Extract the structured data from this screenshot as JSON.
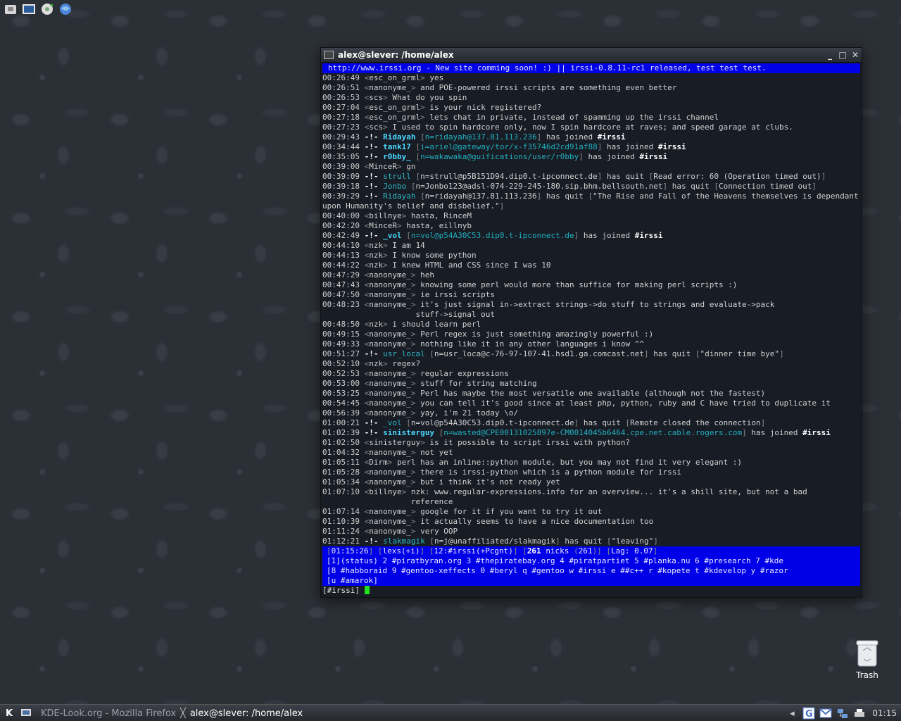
{
  "window": {
    "title": "alex@slever: /home/alex",
    "controls": [
      "_",
      "□",
      "✕"
    ]
  },
  "irssi": {
    "topic": "http://www.irssi.org - New site comming soon! :) || irssi-0.8.11-rc1 released, test test test.",
    "messages": [
      {
        "time": "00:26:49",
        "nick": "esc_on_grml",
        "text": "yes"
      },
      {
        "time": "00:26:51",
        "nick": "nanonyme_",
        "text": "and POE-powered irssi scripts are something even better"
      },
      {
        "time": "00:26:53",
        "nick": "scs",
        "text": "What do you spin"
      },
      {
        "time": "00:27:04",
        "nick": "esc_on_grml",
        "text": "is your nick registered?"
      },
      {
        "time": "00:27:18",
        "nick": "esc_on_grml",
        "text": "lets chat in private, instead of spamming up the irssi channel"
      },
      {
        "time": "00:27:23",
        "nick": "scs",
        "text": "I used to spin hardcore only, now I spin hardcore at raves; and speed garage at clubs."
      },
      {
        "time": "00:29:43",
        "type": "join",
        "nick": "Ridayah",
        "host": "n=ridayah@137.81.113.236",
        "channel": "#irssi"
      },
      {
        "time": "00:34:44",
        "type": "join",
        "nick": "tank17",
        "host": "i=ariel@gateway/tor/x-f35746d2cd91af88",
        "channel": "#irssi"
      },
      {
        "time": "00:35:05",
        "type": "join",
        "nick": "r0bby_",
        "host": "n=wakawaka@guifications/user/r0bby",
        "channel": "#irssi"
      },
      {
        "time": "00:39:00",
        "nick": "MinceR",
        "text": "gn"
      },
      {
        "time": "00:39:09",
        "type": "quit",
        "nick": "strull",
        "host": "n=strull@p5B151D94.dip0.t-ipconnect.de",
        "reason": "Read error: 60 (Operation timed out)"
      },
      {
        "time": "00:39:18",
        "type": "quit",
        "nick": "Jonbo",
        "host": "n=Jonbo123@adsl-074-229-245-180.sip.bhm.bellsouth.net",
        "reason": "Connection timed out"
      },
      {
        "time": "00:39:29",
        "type": "quit",
        "nick": "Ridayah",
        "host": "n=ridayah@137.81.113.236",
        "reason": "\"The Rise and Fall of the Heavens themselves is dependant upon Humanity's belief and disbelief.\"",
        "wrap": true
      },
      {
        "time": "00:40:00",
        "nick": "billnye",
        "text": "hasta, RinceM"
      },
      {
        "time": "00:42:20",
        "nick": "MinceR",
        "text": "hasta, eillnyb"
      },
      {
        "time": "00:42:49",
        "type": "join",
        "nick": "_vol",
        "host": "n=vol@p54A30C53.dip0.t-ipconnect.de",
        "channel": "#irssi"
      },
      {
        "time": "00:44:10",
        "nick": "nzk",
        "text": "I am 14"
      },
      {
        "time": "00:44:13",
        "nick": "nzk",
        "text": "I know some python"
      },
      {
        "time": "00:44:22",
        "nick": "nzk",
        "text": "I knew HTML and CSS since I was 10"
      },
      {
        "time": "00:47:29",
        "nick": "nanonyme_",
        "text": "heh"
      },
      {
        "time": "00:47:43",
        "nick": "nanonyme_",
        "text": "knowing some perl would more than suffice for making perl scripts :)"
      },
      {
        "time": "00:47:50",
        "nick": "nanonyme_",
        "text": "ie irssi scripts"
      },
      {
        "time": "00:48:23",
        "nick": "nanonyme_",
        "text": "it's just signal in->extract strings->do stuff to strings and evaluate->pack\n                    stuff->signal out",
        "wrap": true
      },
      {
        "time": "00:48:50",
        "nick": "nzk",
        "text": "i should learn perl"
      },
      {
        "time": "00:49:15",
        "nick": "nanonyme_",
        "text": "Perl regex is just something amazingly powerful :)"
      },
      {
        "time": "00:49:33",
        "nick": "nanonyme_",
        "text": "nothing like it in any other languages i know ^^"
      },
      {
        "time": "00:51:27",
        "type": "quit",
        "nick": "usr_local",
        "host": "n=usr_loca@c-76-97-107-41.hsd1.ga.comcast.net",
        "reason": "\"dinner time bye\""
      },
      {
        "time": "00:52:10",
        "nick": "nzk",
        "text": "regex?"
      },
      {
        "time": "00:52:53",
        "nick": "nanonyme_",
        "text": "regular expressions"
      },
      {
        "time": "00:53:00",
        "nick": "nanonyme_",
        "text": "stuff for string matching"
      },
      {
        "time": "00:53:25",
        "nick": "nanonyme_",
        "text": "Perl has maybe the most versatile one available (although not the fastest)"
      },
      {
        "time": "00:54:45",
        "nick": "nanonyme_",
        "text": "you can tell it's good since at least php, python, ruby and C have tried to duplicate it"
      },
      {
        "time": "00:56:39",
        "nick": "nanonyme_",
        "text": "yay, i'm 21 today \\o/"
      },
      {
        "time": "01:00:21",
        "type": "quit",
        "nick": "_vol",
        "host": "n=vol@p54A30C53.dip0.t-ipconnect.de",
        "reason": "Remote closed the connection"
      },
      {
        "time": "01:02:39",
        "type": "join",
        "nick": "sinisterguy",
        "host": "n=wasted@CPE00131025897e-CM0014045b6464.cpe.net.cable.rogers.com",
        "channel": "#irssi"
      },
      {
        "time": "01:02:50",
        "nick": "sinisterguy",
        "text": "is it possible to script irssi with python?"
      },
      {
        "time": "01:04:32",
        "nick": "nanonyme_",
        "text": "not yet"
      },
      {
        "time": "01:05:11",
        "nick": "Dirm",
        "text": "perl has an inline::python module, but you may not find it very elegant :)"
      },
      {
        "time": "01:05:28",
        "nick": "nanonyme_",
        "text": "there is irssi-python which is a python module for irssi"
      },
      {
        "time": "01:05:34",
        "nick": "nanonyme_",
        "text": "but i think it's not ready yet"
      },
      {
        "time": "01:07:10",
        "nick": "billnye",
        "text": "nzk: www.regular-expressions.info for an overview... it's a shill site, but not a bad\n                   reference",
        "wrap": true
      },
      {
        "time": "01:07:14",
        "nick": "nanonyme_",
        "text": "google for it if you want to try it out"
      },
      {
        "time": "01:10:39",
        "nick": "nanonyme_",
        "text": "it actually seems to have a nice documentation too"
      },
      {
        "time": "01:11:24",
        "nick": "nanonyme_",
        "text": "very OOP"
      },
      {
        "time": "01:12:21",
        "type": "quit",
        "nick": "slakmagik",
        "host": "n=j@unaffiliated/slakmagik",
        "reason": "\"leaving\""
      }
    ],
    "status": {
      "time": "01:15:26",
      "user": "lexs(+i)",
      "window": "12:#irssi(+Pcgnt)",
      "nicks_count": "261",
      "nicks_label": "nicks",
      "nicks_detail": "261",
      "lag": "Lag: 0.07"
    },
    "activity_lines": [
      "[1](status) 2 #piratbyran.org 3 #thepiratebay.org 4 #piratpartiet 5 #planka.nu 6 #presearch 7 #kde",
      "[8 #habboraid 9 #gentoo-xeffects 0 #beryl q #gentoo w #irssi e ##c++ r #kopete t #kdevelop y #razor",
      "[u #amarok]"
    ],
    "input_prompt": "[#irssi]"
  },
  "desktop": {
    "trash_label": "Trash"
  },
  "taskbar": {
    "start_icon": "kde-icon",
    "tasks": [
      {
        "label": "KDE-Look.org - Mozilla Firefox",
        "active": false
      },
      {
        "label": "alex@slever: /home/alex",
        "active": true
      }
    ],
    "clock": "01:15"
  }
}
